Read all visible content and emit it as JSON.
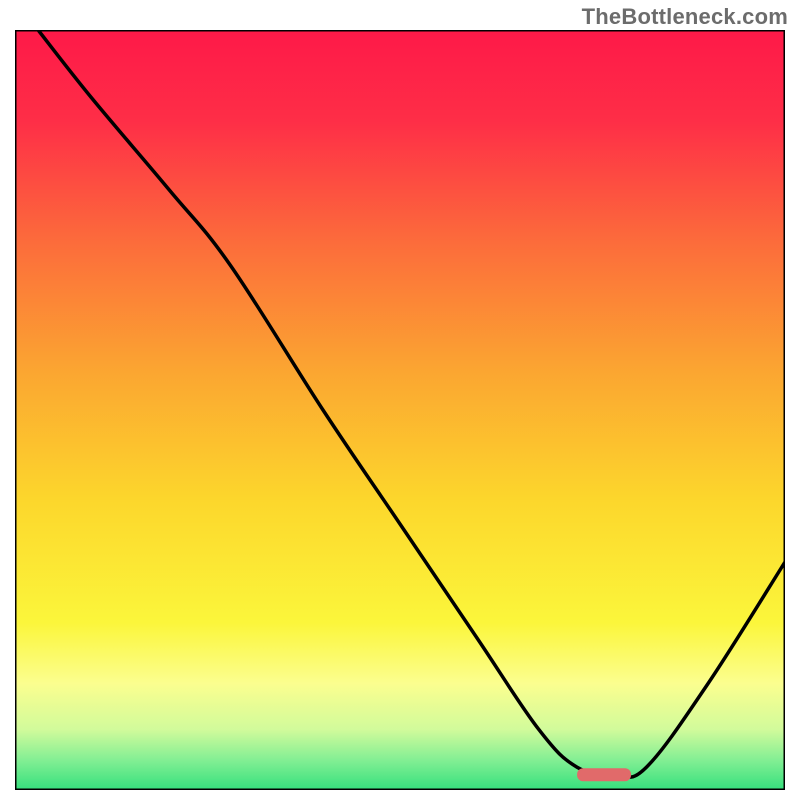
{
  "watermark": "TheBottleneck.com",
  "chart_data": {
    "type": "line",
    "title": "",
    "xlabel": "",
    "ylabel": "",
    "xlim": [
      0,
      100
    ],
    "ylim": [
      0,
      100
    ],
    "x": [
      3,
      10,
      20,
      28,
      40,
      50,
      60,
      68,
      73,
      78,
      82,
      90,
      100
    ],
    "values": [
      100,
      91,
      79,
      69,
      50,
      35,
      20,
      8,
      3,
      2,
      3,
      14,
      30
    ],
    "marker": {
      "x_start": 73,
      "x_end": 80,
      "y": 2,
      "color": "#e16a6a"
    },
    "axes_visible": false,
    "grid": false,
    "background_gradient": {
      "stops": [
        {
          "offset": 0.0,
          "color": "#fe1948"
        },
        {
          "offset": 0.12,
          "color": "#fe2e47"
        },
        {
          "offset": 0.28,
          "color": "#fc6c3b"
        },
        {
          "offset": 0.45,
          "color": "#fba631"
        },
        {
          "offset": 0.62,
          "color": "#fcd72c"
        },
        {
          "offset": 0.78,
          "color": "#fbf63b"
        },
        {
          "offset": 0.86,
          "color": "#fbfe8f"
        },
        {
          "offset": 0.92,
          "color": "#d2fb9b"
        },
        {
          "offset": 0.96,
          "color": "#84ef94"
        },
        {
          "offset": 1.0,
          "color": "#35e07d"
        }
      ]
    }
  }
}
